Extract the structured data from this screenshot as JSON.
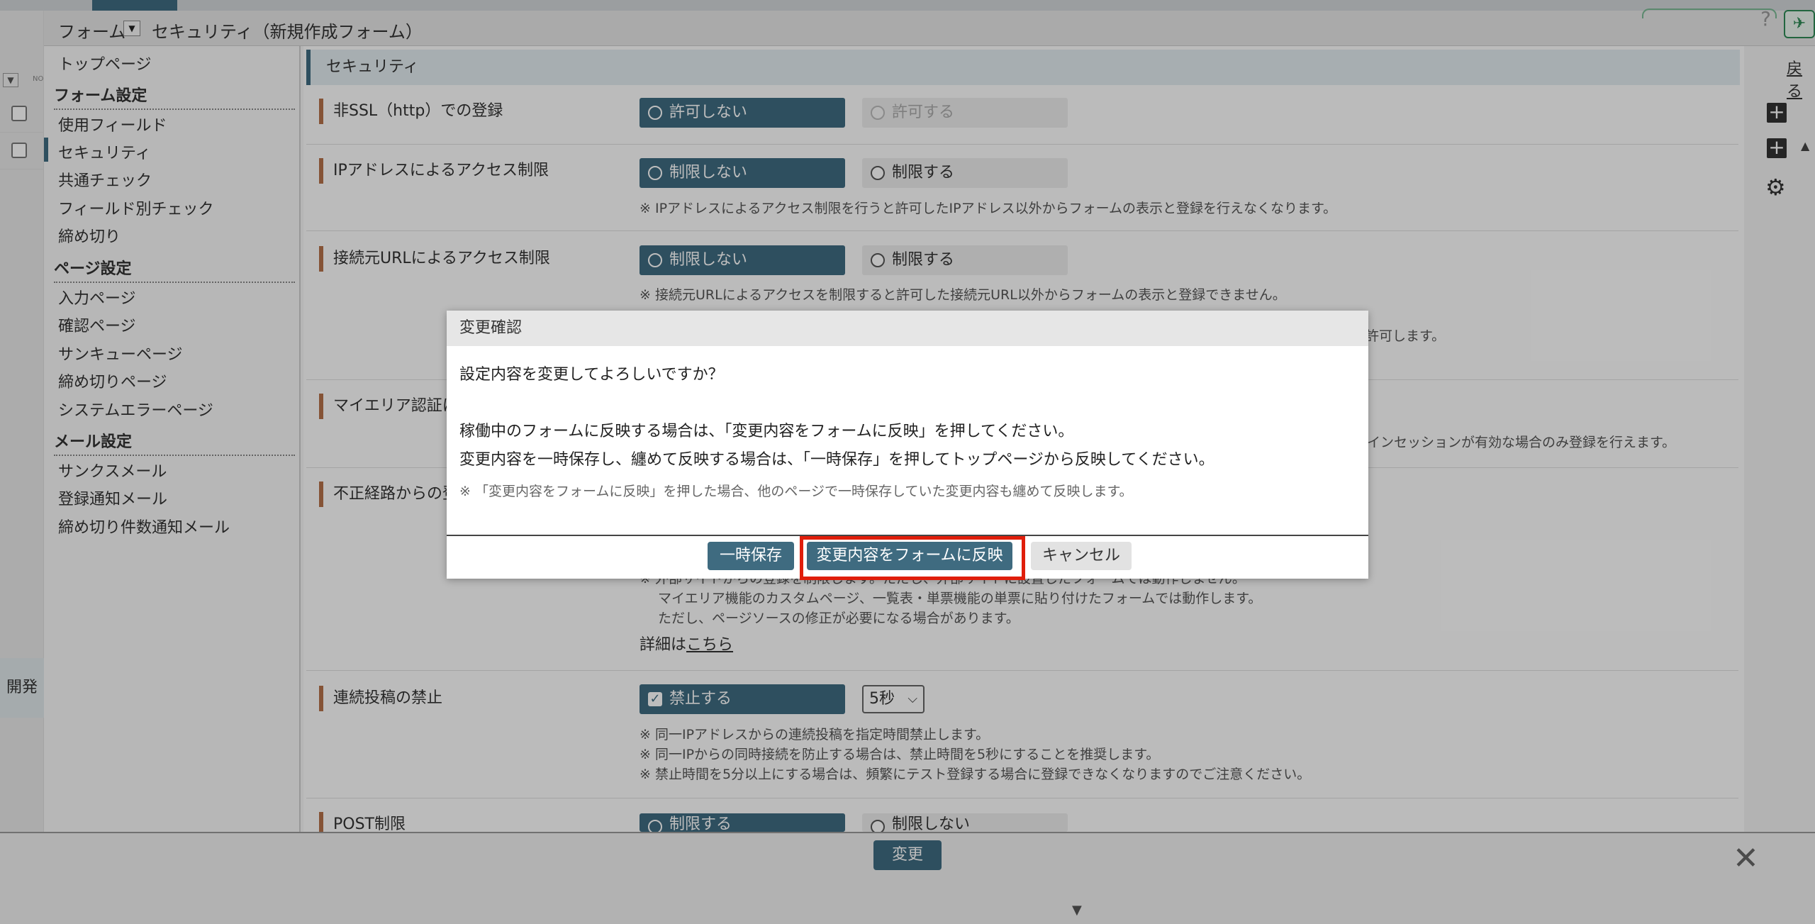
{
  "titlebar": {
    "form_label": "フォーム",
    "page_title": "セキュリティ（新規作成フォーム）",
    "help": "?"
  },
  "left_strip": {
    "no_label": "NO",
    "dev_label": "開発"
  },
  "menu": {
    "top": "トップページ",
    "sections": [
      {
        "title": "フォーム設定",
        "items": [
          "使用フィールド",
          "セキュリティ",
          "共通チェック",
          "フィールド別チェック",
          "締め切り"
        ]
      },
      {
        "title": "ページ設定",
        "items": [
          "入力ページ",
          "確認ページ",
          "サンキューページ",
          "締め切りページ",
          "システムエラーページ"
        ]
      },
      {
        "title": "メール設定",
        "items": [
          "サンクスメール",
          "登録通知メール",
          "締め切り件数通知メール"
        ]
      }
    ]
  },
  "main": {
    "section_title": "セキュリティ",
    "rows": [
      {
        "label": "非SSL（http）での登録",
        "opt1": "許可しない",
        "opt2": "許可する"
      },
      {
        "label": "IPアドレスによるアクセス制限",
        "opt1": "制限しない",
        "opt2": "制限する",
        "note": "※ IPアドレスによるアクセス制限を行うと許可したIPアドレス以外からフォームの表示と登録を行えなくなります。"
      },
      {
        "label": "接続元URLによるアクセス制限",
        "opt1": "制限しない",
        "opt2": "制限する",
        "note1": "※ 接続元URLによるアクセスを制限すると許可した接続元URL以外からフォームの表示と登録できません。",
        "note2_tail": "許可します。"
      },
      {
        "label": "マイエリア認証に",
        "note_tail": "インセッションが有効な場合のみ登録を行えます。"
      },
      {
        "label": "不正経路からの登",
        "note_a": "※ 外部サイトからの登録を制限します。ただし、外部サイトに設置したフォームでは動作しません。",
        "note_b": "マイエリア機能のカスタムページ、一覧表・単票機能の単票に貼り付けたフォームでは動作します。",
        "note_c": "ただし、ページソースの修正が必要になる場合があります。",
        "detail_prefix": "詳細は",
        "detail_link": "こちら"
      },
      {
        "label": "連続投稿の禁止",
        "opt1": "禁止する",
        "select_value": "5秒",
        "notes": [
          "※ 同一IPアドレスからの連続投稿を指定時間禁止します。",
          "※ 同一IPからの同時接続を防止する場合は、禁止時間を5秒にすることを推奨します。",
          "※ 禁止時間を5分以上にする場合は、頻繁にテスト登録する場合に登録できなくなりますのでご注意ください。"
        ]
      },
      {
        "label": "POST制限",
        "opt1": "制限する",
        "opt2": "制限しない"
      }
    ]
  },
  "rightbar": {
    "back": "戻る"
  },
  "footer": {
    "change": "変更",
    "close": "✕"
  },
  "dialog": {
    "title": "変更確認",
    "line1": "設定内容を変更してよろしいですか？",
    "line2": "稼働中のフォームに反映する場合は、「変更内容をフォームに反映」を押してください。",
    "line3": "変更内容を一時保存し、纏めて反映する場合は、「一時保存」を押してトップページから反映してください。",
    "note": "※ 「変更内容をフォームに反映」を押した場合、他のページで一時保存していた変更内容も纏めて反映します。",
    "btn_temp": "一時保存",
    "btn_apply": "変更内容をフォームに反映",
    "btn_cancel": "キャンセル"
  },
  "colors": {
    "accent": "#3f6b80",
    "highlight": "#e01e0b",
    "label_bar": "#b47049"
  }
}
